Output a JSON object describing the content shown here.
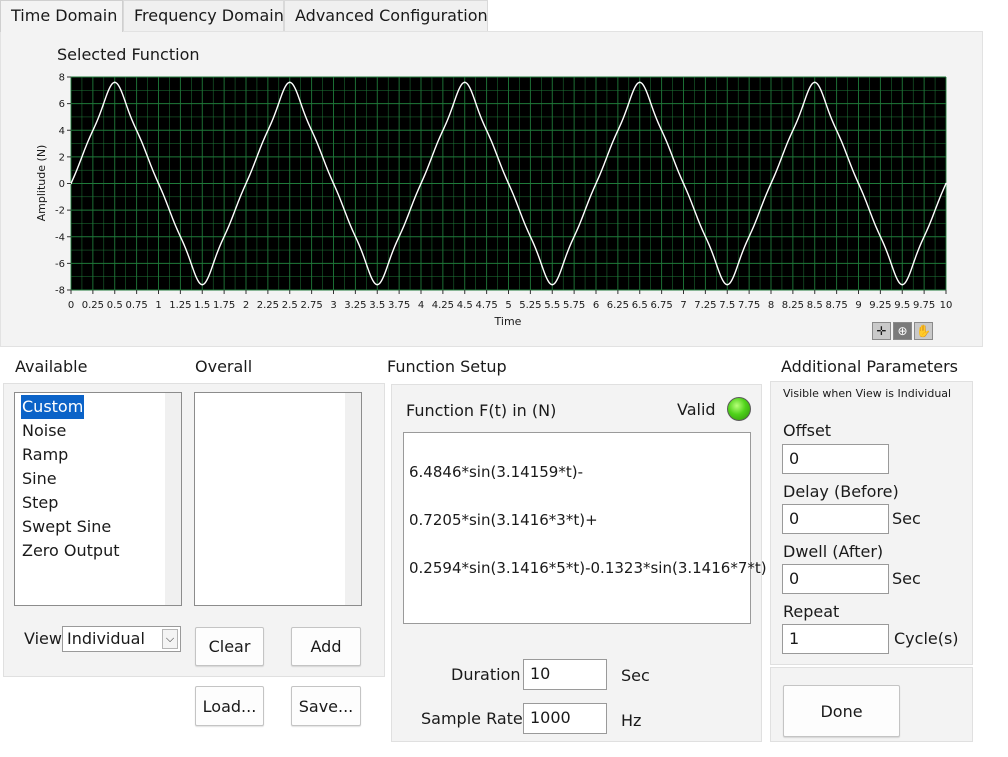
{
  "tabs": [
    {
      "label": "Time Domain",
      "active": true
    },
    {
      "label": "Frequency Domain",
      "active": false
    },
    {
      "label": "Advanced Configuration",
      "active": false
    }
  ],
  "graph": {
    "title": "Selected Function",
    "ylabel": "Amplitude (N)",
    "xlabel": "Time",
    "plot_background": "#000000",
    "grid_color": "#1f7a3a",
    "trace_color": "#ffffff",
    "palette_icons": [
      "crosshair-icon",
      "zoom-icon",
      "pan-hand-icon"
    ]
  },
  "chart_data": {
    "type": "line",
    "title": "Selected Function",
    "xlabel": "Time",
    "ylabel": "Amplitude (N)",
    "xlim": [
      0,
      10
    ],
    "ylim": [
      -8,
      8
    ],
    "grid": true,
    "x_ticks": [
      "0",
      "0.25",
      "0.5",
      "0.75",
      "1",
      "1.25",
      "1.5",
      "1.75",
      "2",
      "2.25",
      "2.5",
      "2.75",
      "3",
      "3.25",
      "3.5",
      "3.75",
      "4",
      "4.25",
      "4.5",
      "4.75",
      "5",
      "5.25",
      "5.5",
      "5.75",
      "6",
      "6.25",
      "6.5",
      "6.75",
      "7",
      "7.25",
      "7.5",
      "7.75",
      "8",
      "8.25",
      "8.5",
      "8.75",
      "9",
      "9.25",
      "9.5",
      "9.75",
      "10"
    ],
    "y_ticks": [
      "8",
      "6",
      "4",
      "2",
      "0",
      "-2",
      "-4",
      "-6",
      "-8"
    ],
    "series": [
      {
        "color": "#ffffff",
        "expression": "6.4846*sin(3.14159*t)-0.7205*sin(3.1416*3*t)+0.2594*sin(3.1416*5*t)-0.1323*sin(3.1416*7*t)",
        "x": [
          0,
          0.5,
          1,
          1.5,
          2,
          2.5,
          3,
          3.5,
          4,
          4.5,
          5,
          5.5,
          6,
          6.5,
          7,
          7.5,
          8,
          8.5,
          9,
          9.5,
          10
        ],
        "y": [
          0,
          7.6,
          0,
          -7.6,
          0,
          7.6,
          0,
          -7.6,
          0,
          7.6,
          0,
          -7.6,
          0,
          7.6,
          0,
          -7.6,
          0,
          7.6,
          0,
          -7.6,
          0
        ]
      }
    ]
  },
  "available": {
    "label": "Available",
    "items": [
      "Custom",
      "Noise",
      "Ramp",
      "Sine",
      "Step",
      "Swept Sine",
      "Zero Output"
    ],
    "selected_index": 0
  },
  "overall": {
    "label": "Overall",
    "items": []
  },
  "view": {
    "label": "View",
    "value": "Individual"
  },
  "buttons": {
    "clear": "Clear",
    "add": "Add",
    "load": "Load...",
    "save": "Save...",
    "done": "Done"
  },
  "function_setup": {
    "label": "Function Setup",
    "field_label": "Function F(t) in (N)",
    "valid_label": "Valid",
    "valid_color": "#4fd21a",
    "expression_lines": [
      "6.4846*sin(3.14159*t)-",
      "0.7205*sin(3.1416*3*t)+",
      "0.2594*sin(3.1416*5*t)-0.1323*sin(3.1416*7*t)"
    ],
    "duration_label": "Duration",
    "duration_value": "10",
    "duration_unit": "Sec",
    "sample_rate_label": "Sample Rate",
    "sample_rate_value": "1000",
    "sample_rate_unit": "Hz"
  },
  "additional": {
    "label": "Additional Parameters",
    "note": "Visible when View is Individual",
    "offset_label": "Offset",
    "offset_value": "0",
    "delay_label": "Delay (Before)",
    "delay_value": "0",
    "delay_unit": "Sec",
    "dwell_label": "Dwell (After)",
    "dwell_value": "0",
    "dwell_unit": "Sec",
    "repeat_label": "Repeat",
    "repeat_value": "1",
    "repeat_unit": "Cycle(s)"
  }
}
